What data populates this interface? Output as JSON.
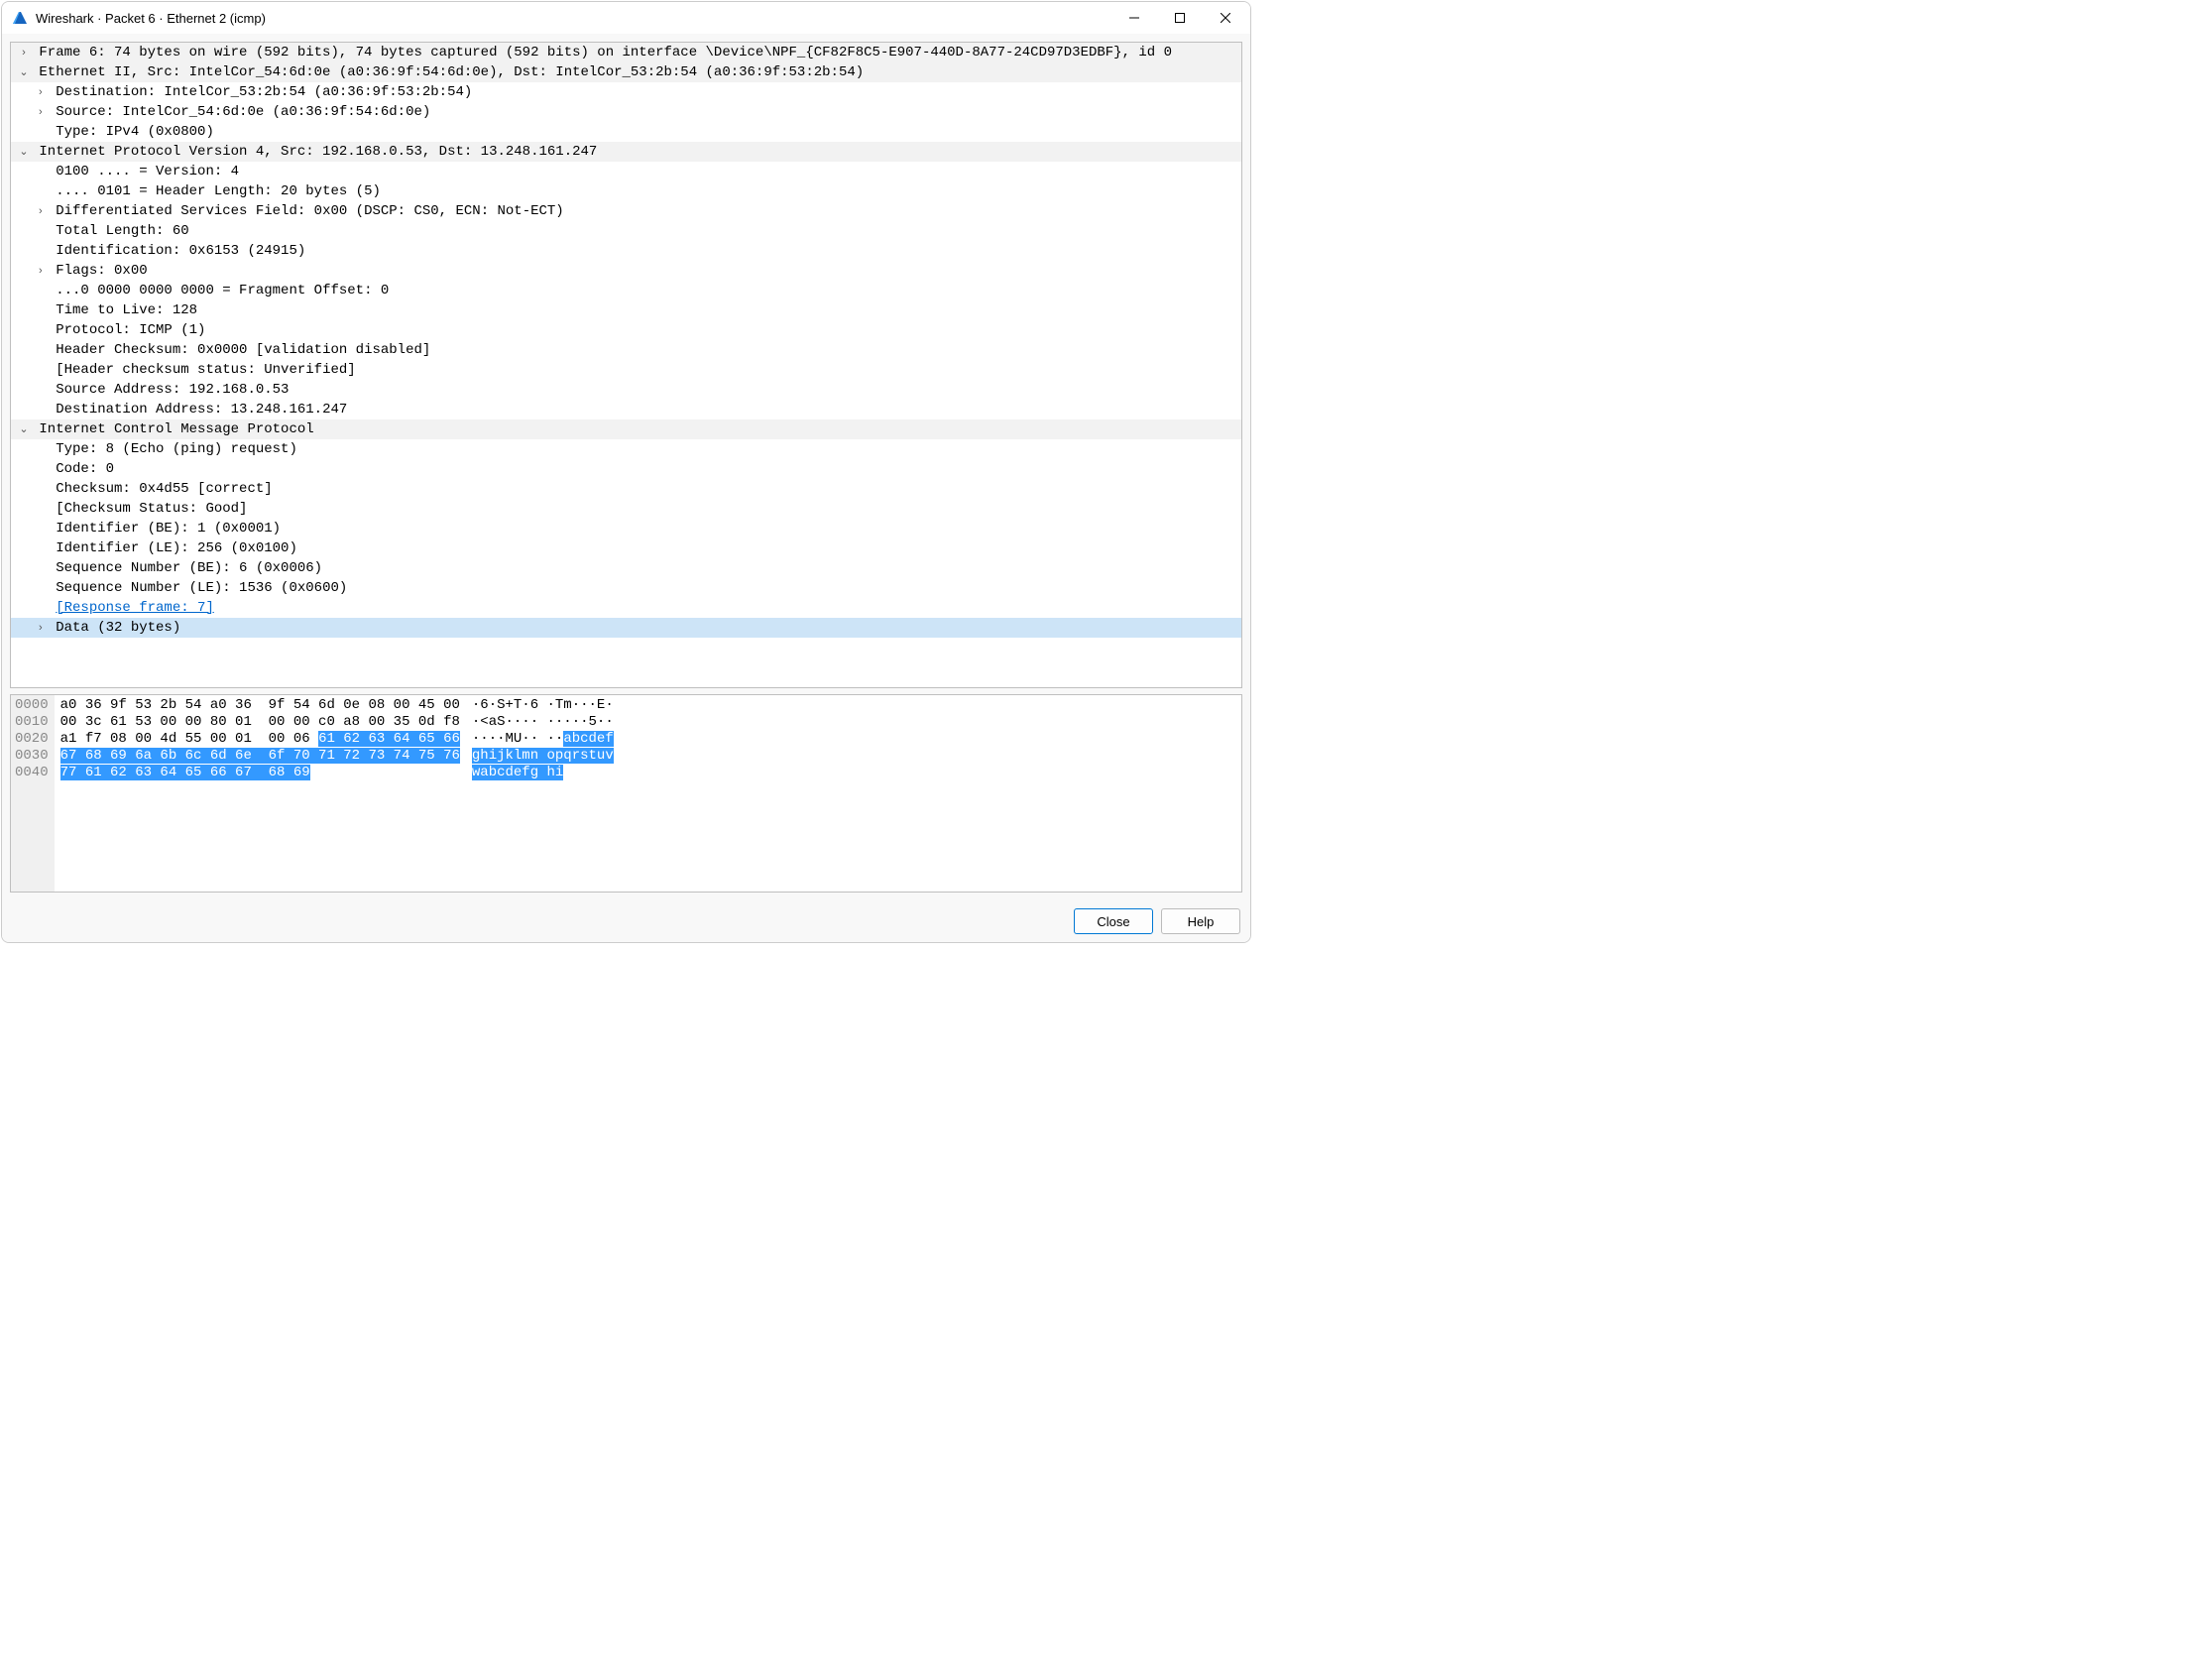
{
  "window": {
    "title": "Wireshark · Packet 6 · Ethernet 2 (icmp)"
  },
  "tree": [
    {
      "indent": 0,
      "chevron": "right",
      "header": true,
      "text": "Frame 6: 74 bytes on wire (592 bits), 74 bytes captured (592 bits) on interface \\Device\\NPF_{CF82F8C5-E907-440D-8A77-24CD97D3EDBF}, id 0"
    },
    {
      "indent": 0,
      "chevron": "down",
      "header": true,
      "text": "Ethernet II, Src: IntelCor_54:6d:0e (a0:36:9f:54:6d:0e), Dst: IntelCor_53:2b:54 (a0:36:9f:53:2b:54)"
    },
    {
      "indent": 1,
      "chevron": "right",
      "text": "Destination: IntelCor_53:2b:54 (a0:36:9f:53:2b:54)"
    },
    {
      "indent": 1,
      "chevron": "right",
      "text": "Source: IntelCor_54:6d:0e (a0:36:9f:54:6d:0e)"
    },
    {
      "indent": 1,
      "chevron": "",
      "text": "Type: IPv4 (0x0800)"
    },
    {
      "indent": 0,
      "chevron": "down",
      "header": true,
      "text": "Internet Protocol Version 4, Src: 192.168.0.53, Dst: 13.248.161.247"
    },
    {
      "indent": 1,
      "chevron": "",
      "text": "0100 .... = Version: 4"
    },
    {
      "indent": 1,
      "chevron": "",
      "text": ".... 0101 = Header Length: 20 bytes (5)"
    },
    {
      "indent": 1,
      "chevron": "right",
      "text": "Differentiated Services Field: 0x00 (DSCP: CS0, ECN: Not-ECT)"
    },
    {
      "indent": 1,
      "chevron": "",
      "text": "Total Length: 60"
    },
    {
      "indent": 1,
      "chevron": "",
      "text": "Identification: 0x6153 (24915)"
    },
    {
      "indent": 1,
      "chevron": "right",
      "text": "Flags: 0x00"
    },
    {
      "indent": 1,
      "chevron": "",
      "text": "...0 0000 0000 0000 = Fragment Offset: 0"
    },
    {
      "indent": 1,
      "chevron": "",
      "text": "Time to Live: 128"
    },
    {
      "indent": 1,
      "chevron": "",
      "text": "Protocol: ICMP (1)"
    },
    {
      "indent": 1,
      "chevron": "",
      "text": "Header Checksum: 0x0000 [validation disabled]"
    },
    {
      "indent": 1,
      "chevron": "",
      "text": "[Header checksum status: Unverified]"
    },
    {
      "indent": 1,
      "chevron": "",
      "text": "Source Address: 192.168.0.53"
    },
    {
      "indent": 1,
      "chevron": "",
      "text": "Destination Address: 13.248.161.247"
    },
    {
      "indent": 0,
      "chevron": "down",
      "header": true,
      "text": "Internet Control Message Protocol"
    },
    {
      "indent": 1,
      "chevron": "",
      "text": "Type: 8 (Echo (ping) request)"
    },
    {
      "indent": 1,
      "chevron": "",
      "text": "Code: 0"
    },
    {
      "indent": 1,
      "chevron": "",
      "text": "Checksum: 0x4d55 [correct]"
    },
    {
      "indent": 1,
      "chevron": "",
      "text": "[Checksum Status: Good]"
    },
    {
      "indent": 1,
      "chevron": "",
      "text": "Identifier (BE): 1 (0x0001)"
    },
    {
      "indent": 1,
      "chevron": "",
      "text": "Identifier (LE): 256 (0x0100)"
    },
    {
      "indent": 1,
      "chevron": "",
      "text": "Sequence Number (BE): 6 (0x0006)"
    },
    {
      "indent": 1,
      "chevron": "",
      "text": "Sequence Number (LE): 1536 (0x0600)"
    },
    {
      "indent": 1,
      "chevron": "",
      "link": true,
      "text": "[Response frame: 7]"
    },
    {
      "indent": 1,
      "chevron": "right",
      "selected": true,
      "text": "Data (32 bytes)"
    }
  ],
  "hex": {
    "rows": [
      {
        "offset": "0000",
        "bytes": [
          {
            "t": "a0 36 9f 53 2b 54 a0 36  9f 54 6d 0e 08 00 45 00"
          }
        ],
        "ascii": [
          {
            "t": "·6·S+T·6 ·Tm···E·"
          }
        ]
      },
      {
        "offset": "0010",
        "bytes": [
          {
            "t": "00 3c 61 53 00 00 80 01  00 00 c0 a8 00 35 0d f8"
          }
        ],
        "ascii": [
          {
            "t": "·<aS···· ·····5··"
          }
        ]
      },
      {
        "offset": "0020",
        "bytes": [
          {
            "t": "a1 f7 08 00 4d 55 00 01  00 06 "
          },
          {
            "t": "61 62 63 64 65 66",
            "hl": true
          }
        ],
        "ascii": [
          {
            "t": "····MU·· ··"
          },
          {
            "t": "abcdef",
            "hl": true
          }
        ]
      },
      {
        "offset": "0030",
        "bytes": [
          {
            "t": "67 68 69 6a 6b 6c 6d 6e  6f 70 71 72 73 74 75 76",
            "hl": true
          }
        ],
        "ascii": [
          {
            "t": "ghijklmn opqrstuv",
            "hl": true
          }
        ]
      },
      {
        "offset": "0040",
        "bytes": [
          {
            "t": "77 61 62 63 64 65 66 67  68 69",
            "hl": true
          }
        ],
        "ascii": [
          {
            "t": "wabcdefg hi",
            "hl": true
          }
        ]
      }
    ]
  },
  "buttons": {
    "close": "Close",
    "help": "Help"
  }
}
